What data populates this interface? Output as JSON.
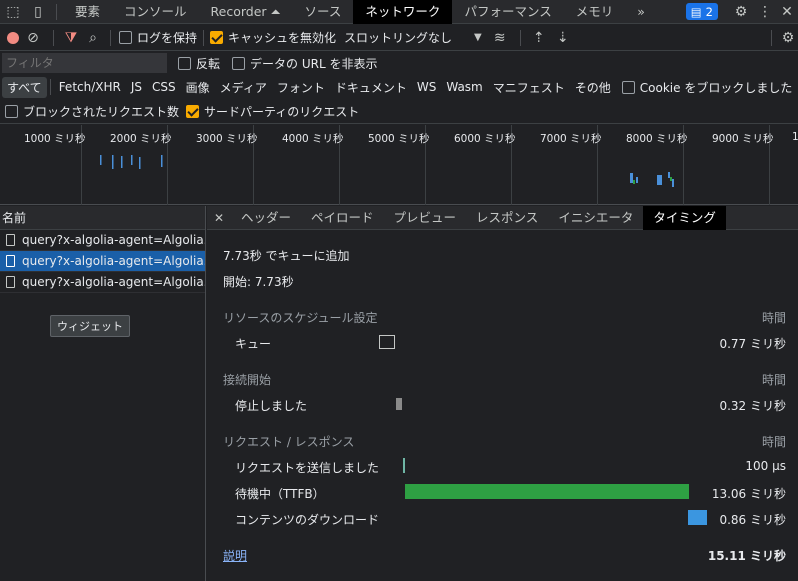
{
  "topbar": {
    "tabs": [
      "要素",
      "コンソール",
      "Recorder ⏶",
      "ソース",
      "ネットワーク",
      "パフォーマンス",
      "メモリ",
      "»"
    ],
    "active": "ネットワーク",
    "badge_count": "2"
  },
  "toolbar": {
    "preserve_log": "ログを保持",
    "disable_cache": "キャッシュを無効化",
    "throttle": "スロットリングなし"
  },
  "filter": {
    "placeholder": "フィルタ",
    "invert": "反転",
    "hide_data_urls": "データの URL を非表示"
  },
  "type_filters": [
    "すべて",
    "Fetch/XHR",
    "JS",
    "CSS",
    "画像",
    "メディア",
    "フォント",
    "ドキュメント",
    "WS",
    "Wasm",
    "マニフェスト",
    "その他"
  ],
  "blocked_cookies": "Cookie をブロックしました",
  "blocked_requests": "ブロックされたリクエスト数",
  "third_party": "サードパーティのリクエスト",
  "timeline_ticks": [
    "1000 ミリ秒",
    "2000 ミリ秒",
    "3000 ミリ秒",
    "4000 ミリ秒",
    "5000 ミリ秒",
    "6000 ミリ秒",
    "7000 ミリ秒",
    "8000 ミリ秒",
    "9000 ミリ秒",
    "1"
  ],
  "list": {
    "header": "名前",
    "items": [
      "query?x-algolia-agent=Algolia...",
      "query?x-algolia-agent=Algolia...",
      "query?x-algolia-agent=Algolia..."
    ],
    "tooltip": "ウィジェット"
  },
  "detail": {
    "tabs": [
      "ヘッダー",
      "ペイロード",
      "プレビュー",
      "レスポンス",
      "イニシエータ",
      "タイミング"
    ],
    "active": "タイミング",
    "queued_at": "7.73秒 でキューに追加",
    "started_at": "開始: 7.73秒",
    "time_label": "時間",
    "sections": [
      {
        "title": "リソースのスケジュール設定",
        "rows": [
          {
            "label": "キュー",
            "value": "0.77 ミリ秒"
          }
        ]
      },
      {
        "title": "接続開始",
        "rows": [
          {
            "label": "停止しました",
            "value": "0.32 ミリ秒"
          }
        ]
      },
      {
        "title": "リクエスト / レスポンス",
        "rows": [
          {
            "label": "リクエストを送信しました",
            "value": "100 μs"
          },
          {
            "label": "待機中（TTFB）",
            "value": "13.06 ミリ秒"
          },
          {
            "label": "コンテンツのダウンロード",
            "value": "0.86 ミリ秒"
          }
        ]
      }
    ],
    "explanation": "説明",
    "total": "15.11 ミリ秒"
  },
  "colors": {
    "ttfb": "#2ea043",
    "download": "#3b96e0",
    "stalled": "#8a8a8a",
    "accent": "#f9ab00"
  }
}
